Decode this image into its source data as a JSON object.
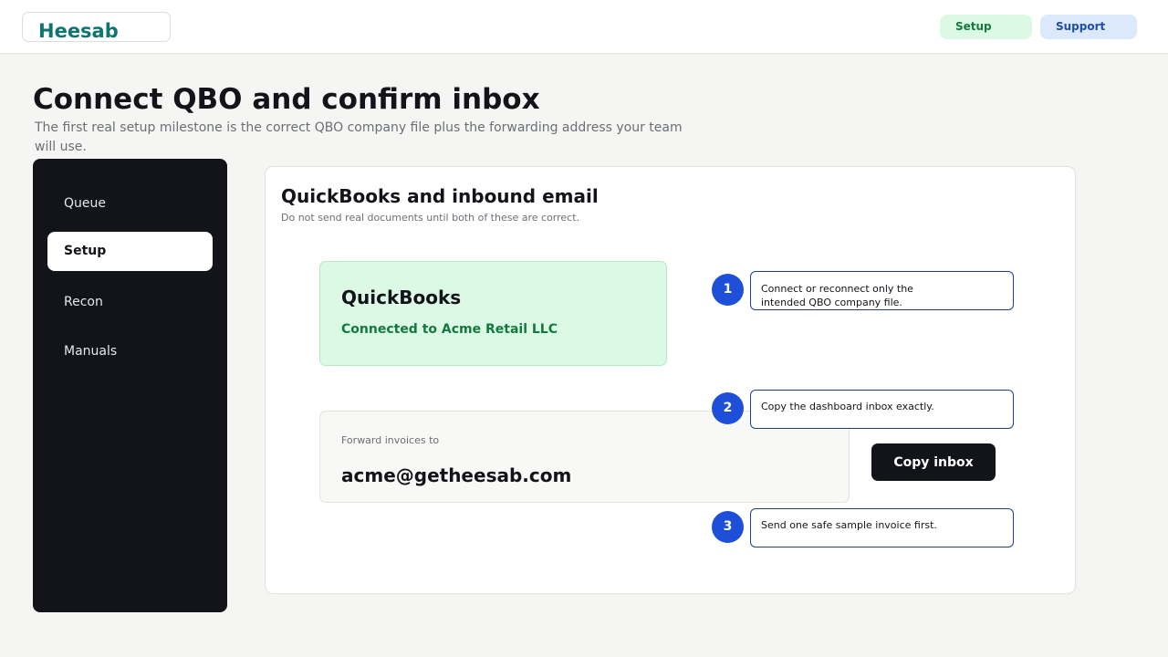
{
  "header": {
    "logo": "Heesab",
    "buttons": {
      "setup": "Setup",
      "support": "Support"
    }
  },
  "page": {
    "title": "Connect QBO and confirm inbox",
    "subtitle": "The first real setup milestone is the correct QBO company file plus the forwarding address your team will use."
  },
  "sidebar": {
    "items": [
      {
        "label": "Queue",
        "active": false
      },
      {
        "label": "Setup",
        "active": true
      },
      {
        "label": "Recon",
        "active": false
      },
      {
        "label": "Manuals",
        "active": false
      }
    ]
  },
  "card": {
    "title": "QuickBooks and inbound email",
    "subtitle": "Do not send real documents until both of these are correct.",
    "quickbooks": {
      "title": "QuickBooks",
      "status": "Connected to Acme Retail LLC"
    },
    "forward": {
      "label": "Forward invoices to",
      "email": "acme@getheesab.com"
    },
    "copy_button": "Copy inbox",
    "steps": [
      {
        "number": "1",
        "text": "Connect or reconnect only the intended QBO company file."
      },
      {
        "number": "2",
        "text": "Copy the dashboard inbox exactly."
      },
      {
        "number": "3",
        "text": "Send one safe sample invoice first."
      }
    ]
  },
  "colors": {
    "brand": "#0f766e",
    "success": "#137a3d",
    "success_bg": "#dcf9e6",
    "info_bg": "#dce8fb",
    "step_accent": "#1d4fd8",
    "sidebar_bg": "#121419"
  }
}
